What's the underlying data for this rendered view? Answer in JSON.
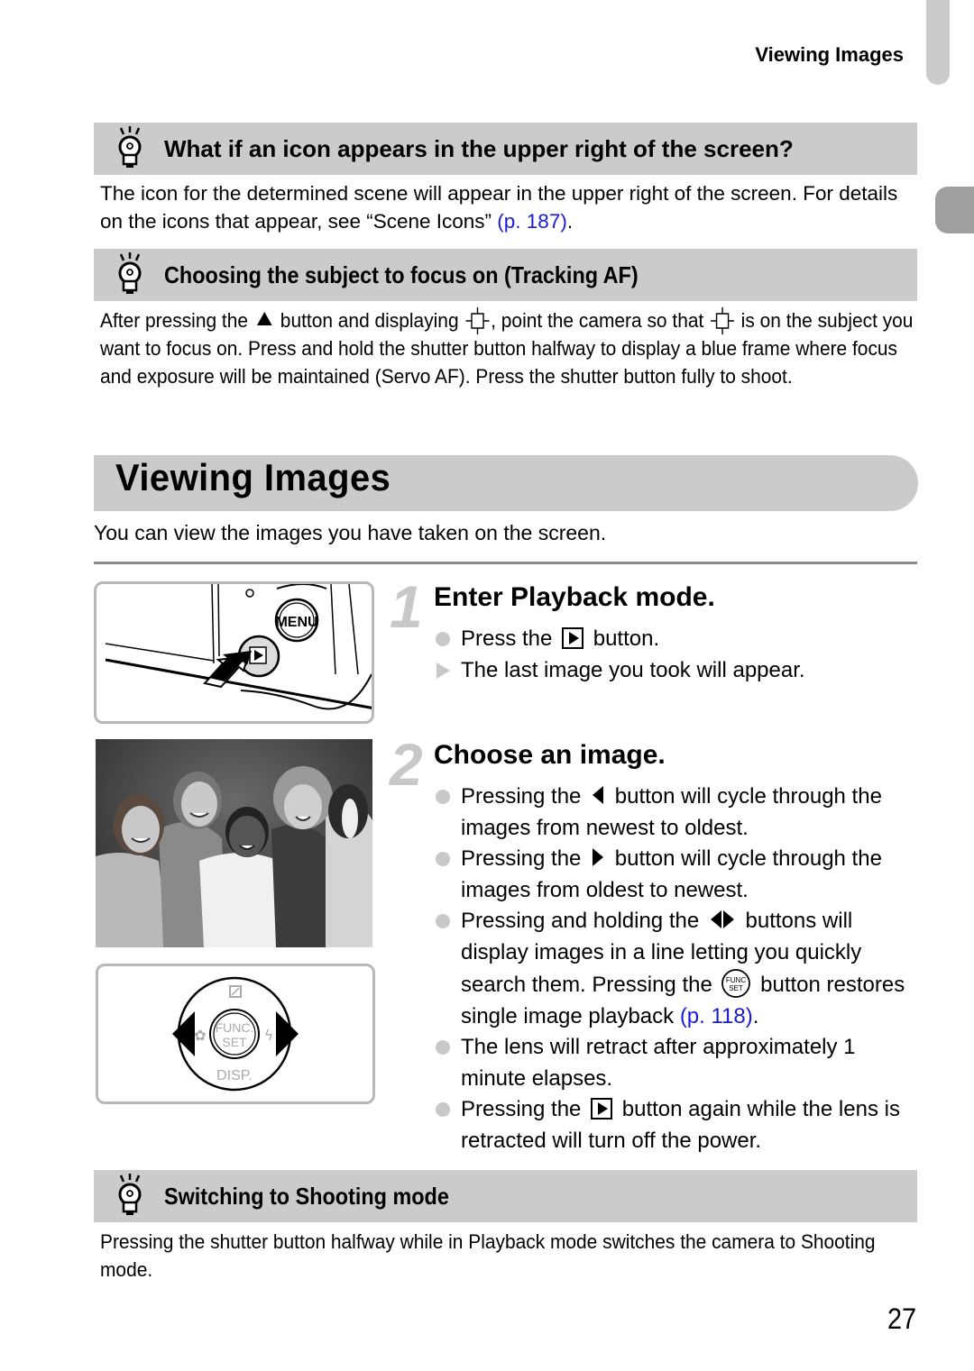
{
  "running_header": "Viewing Images",
  "hints": [
    {
      "title": "What if an icon appears in the upper right of the screen?",
      "body_before_link": "The icon for the determined scene will appear in the upper right of the screen. For details on the icons that appear, see “Scene Icons” ",
      "link": "(p. 187)",
      "body_after_link": "."
    },
    {
      "title": "Choosing the subject to focus on (Tracking AF)",
      "body_part1": "After pressing the ",
      "body_part2": " button and displaying ",
      "body_part3": ", point the camera so that ",
      "body_part4": " is on the subject you want to focus on. Press and hold the shutter button halfway to display a blue frame where focus and exposure will be maintained (Servo AF). Press the shutter button fully to shoot.",
      "icons": [
        "up-button-icon",
        "tracking-af-frame-icon"
      ]
    },
    {
      "title": "Switching to Shooting mode",
      "body": "Pressing the shutter button halfway while in Playback mode switches the camera to Shooting mode."
    }
  ],
  "section": {
    "title": "Viewing Images",
    "intro": "You can view the images you have taken on the screen."
  },
  "figures": {
    "camera": {
      "menu_label": "MENU"
    },
    "dial": {
      "center_top": "FUNC.",
      "center_bottom": "SET",
      "bottom_label": "DISP."
    }
  },
  "steps": [
    {
      "number": "1",
      "title": "Enter Playback mode.",
      "bullets": [
        {
          "type": "dot",
          "before": "Press the ",
          "icon": "playback-button-icon",
          "after": " button."
        },
        {
          "type": "arrow",
          "text": "The last image you took will appear."
        }
      ]
    },
    {
      "number": "2",
      "title": "Choose an image.",
      "bullets": [
        {
          "type": "dot",
          "before": "Pressing the ",
          "icon": "left-button-icon",
          "after": " button will cycle through the images from newest to oldest."
        },
        {
          "type": "dot",
          "before": "Pressing the ",
          "icon": "right-button-icon",
          "after": " button will cycle through the images from oldest to newest."
        },
        {
          "type": "dot",
          "before": "Pressing and holding the ",
          "icon": "left-right-buttons-icon",
          "middle": " buttons will display images in a line letting you quickly search them. Pressing the ",
          "icon2": "func-set-button-icon",
          "after": " button restores single image playback ",
          "link": "(p. 118)",
          "end": "."
        },
        {
          "type": "dot",
          "text": "The lens will retract after approximately 1 minute elapses."
        },
        {
          "type": "dot",
          "before": "Pressing the ",
          "icon": "playback-button-icon",
          "after": " button again while the lens is retracted will turn off the power."
        }
      ]
    }
  ],
  "page_number": "27",
  "colors": {
    "hint_bar": "#cbcbcb",
    "link": "#1a1adf",
    "side_tab": "#9f9f9f",
    "step_number": "#c8c8c8"
  }
}
